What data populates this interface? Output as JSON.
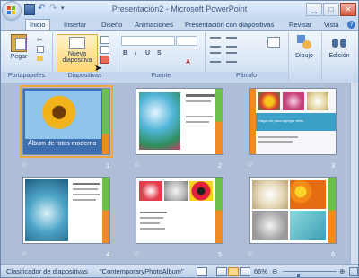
{
  "window": {
    "title": "Presentación2 - Microsoft PowerPoint"
  },
  "tabs": [
    {
      "label": "Inicio",
      "active": true
    },
    {
      "label": "Insertar"
    },
    {
      "label": "Diseño"
    },
    {
      "label": "Animaciones"
    },
    {
      "label": "Presentación con diapositivas"
    },
    {
      "label": "Revisar"
    },
    {
      "label": "Vista"
    }
  ],
  "ribbon": {
    "paste_label": "Pegar",
    "new_slide_label_1": "Nueva",
    "new_slide_label_2": "diapositiva",
    "drawing_label": "Dibujo",
    "editing_label": "Edición",
    "groups": {
      "clipboard": "Portapapeles",
      "slides": "Diapositivas",
      "font": "Fuente",
      "paragraph": "Párrafo"
    },
    "format_buttons": [
      "B",
      "I",
      "U",
      "S",
      "A"
    ]
  },
  "slides": [
    {
      "number": "1",
      "title": "Álbum de fotos moderno",
      "selected": true
    },
    {
      "number": "2"
    },
    {
      "number": "3",
      "caption": "Haga clic para agregar texto"
    },
    {
      "number": "4"
    },
    {
      "number": "5"
    },
    {
      "number": "6"
    }
  ],
  "status": {
    "view": "Clasificador de diapositivas",
    "theme": "\"ContemporaryPhotoAlbum\"",
    "zoom": "66%",
    "zoom_fraction": 0.66
  },
  "colors": {
    "accent_orange": "#f0a644",
    "slide_blue": "#3d6fae",
    "slide_green": "#6bbf4a"
  }
}
